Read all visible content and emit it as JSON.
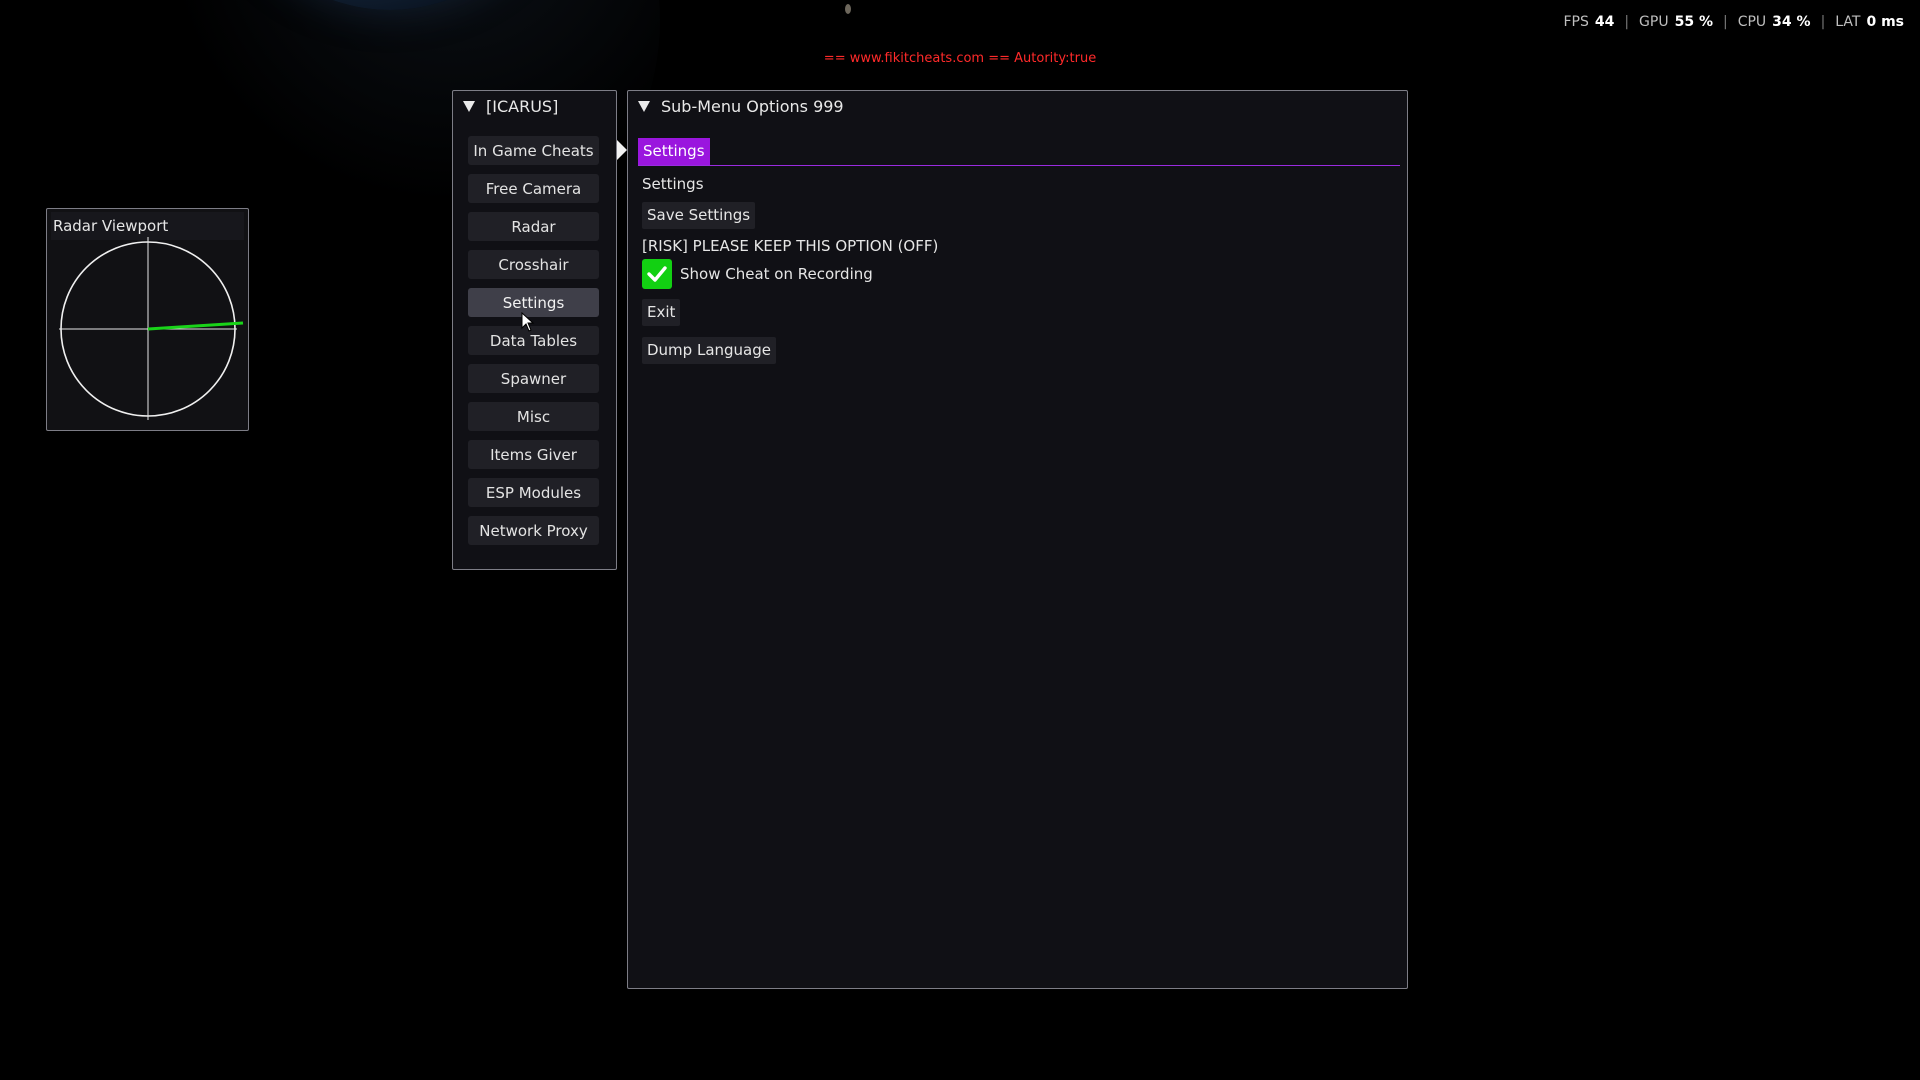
{
  "perf": {
    "fps_label": "FPS",
    "fps_value": "44",
    "gpu_label": "GPU",
    "gpu_value": "55 %",
    "cpu_label": "CPU",
    "cpu_value": "34 %",
    "lat_label": "LAT",
    "lat_value": "0 ms",
    "separator": "|"
  },
  "watermark": "== www.fikitcheats.com == Autority:true",
  "radar": {
    "title": "Radar Viewport"
  },
  "menu": {
    "title": "[ICARUS]",
    "items": [
      {
        "label": "In Game Cheats"
      },
      {
        "label": "Free Camera"
      },
      {
        "label": "Radar"
      },
      {
        "label": "Crosshair"
      },
      {
        "label": "Settings"
      },
      {
        "label": "Data Tables"
      },
      {
        "label": "Spawner"
      },
      {
        "label": "Misc"
      },
      {
        "label": "Items Giver"
      },
      {
        "label": "ESP Modules"
      },
      {
        "label": "Network Proxy"
      }
    ],
    "active_item": "Settings"
  },
  "submenu": {
    "title": "Sub-Menu Options 999",
    "tab": "Settings",
    "section_label": "Settings",
    "save_button": "Save Settings",
    "risk_label": "[RISK] PLEASE KEEP THIS OPTION (OFF)",
    "show_cheat_label": "Show Cheat on Recording",
    "show_cheat_checked": true,
    "exit_button": "Exit",
    "dump_button": "Dump Language"
  },
  "colors": {
    "accent": "#9a16de",
    "checkbox": "#12d012",
    "radar_line": "#19d419",
    "watermark": "#ff2a2a"
  }
}
